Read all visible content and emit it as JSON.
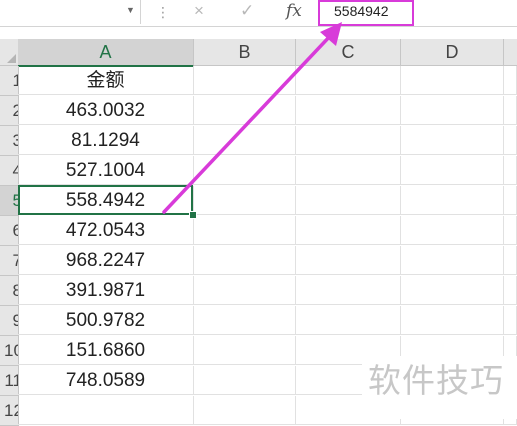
{
  "formula_bar": {
    "name_box": "",
    "cancel_icon": "×",
    "enter_icon": "✓",
    "fx_label": "fx",
    "value": "5584942"
  },
  "columns": [
    "A",
    "B",
    "C",
    "D"
  ],
  "rows": [
    {
      "num": "1",
      "a": "金额"
    },
    {
      "num": "2",
      "a": "463.0032"
    },
    {
      "num": "3",
      "a": "81.1294"
    },
    {
      "num": "4",
      "a": "527.1004"
    },
    {
      "num": "5",
      "a": "558.4942"
    },
    {
      "num": "6",
      "a": "472.0543"
    },
    {
      "num": "7",
      "a": "968.2247"
    },
    {
      "num": "8",
      "a": "391.9871"
    },
    {
      "num": "9",
      "a": "500.9782"
    },
    {
      "num": "10",
      "a": "151.6860"
    },
    {
      "num": "11",
      "a": "748.0589"
    },
    {
      "num": "12",
      "a": ""
    }
  ],
  "selection": {
    "column": "A",
    "row": "5"
  },
  "annotation": {
    "color": "#d83bd9"
  },
  "watermark": "软件技巧",
  "colors": {
    "accent": "#217346",
    "annotation": "#d83bd9"
  }
}
